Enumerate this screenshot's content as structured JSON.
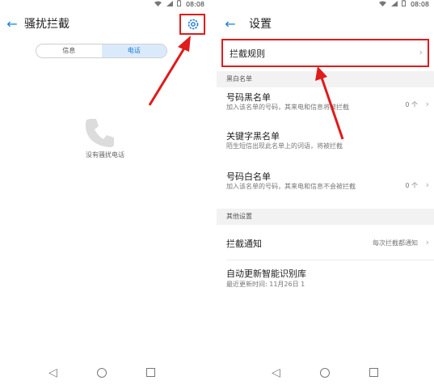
{
  "status": {
    "time": "08:08"
  },
  "left": {
    "title": "骚扰拦截",
    "tabs": [
      "信息",
      "电话"
    ],
    "active_tab": 1,
    "empty_text": "没有骚扰电话"
  },
  "right": {
    "title": "设置",
    "rule_item": "拦截规则",
    "sections": {
      "blackwhite": "黑白名单",
      "other": "其他设置"
    },
    "number_blacklist": {
      "title": "号码黑名单",
      "desc": "加入该名单的号码，其来电和信息将被拦截",
      "count": "0 个"
    },
    "keyword_blacklist": {
      "title": "关键字黑名单",
      "desc": "陌生短信出现此名单上的词语，将被拦截"
    },
    "number_whitelist": {
      "title": "号码白名单",
      "desc": "加入该名单的号码，其来电和信息不会被拦截",
      "count": "0 个"
    },
    "notify": {
      "title": "拦截通知",
      "value": "每次拦截都通知"
    },
    "auto_update": {
      "title": "自动更新智能识别库",
      "desc": "最近更新时间: 11月26日 1"
    }
  },
  "colors": {
    "accent": "#1a7dd7",
    "highlight": "#e01b1b"
  },
  "icons": [
    "back-arrow-icon",
    "gear-icon",
    "phone-icon",
    "chevron-right-icon",
    "nav-back-icon",
    "nav-home-icon",
    "nav-recent-icon"
  ]
}
